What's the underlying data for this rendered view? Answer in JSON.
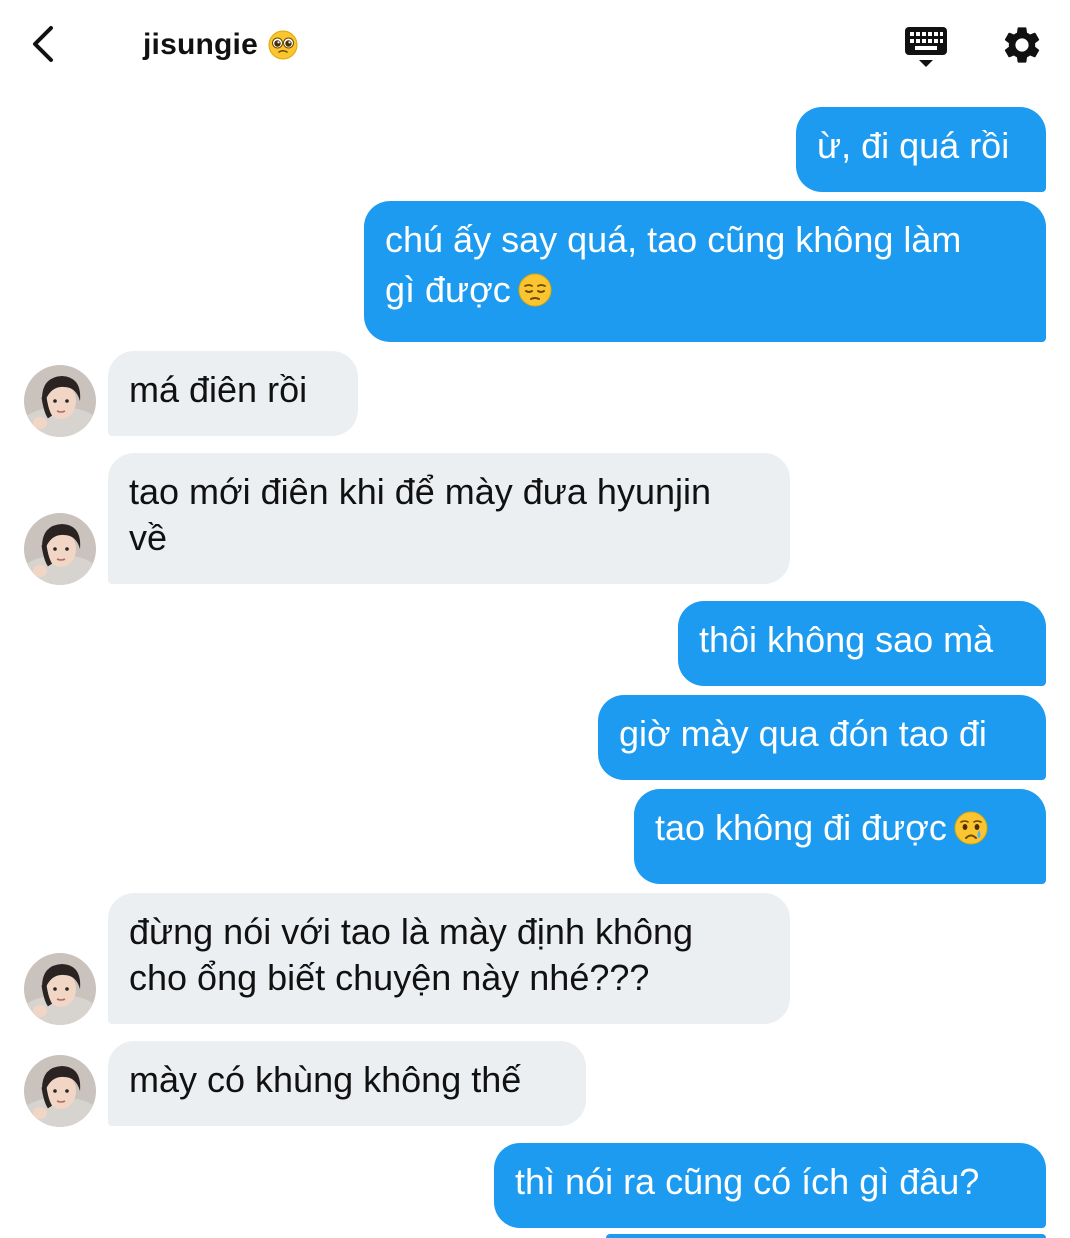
{
  "header": {
    "title": "jisungie",
    "title_emoji": "pleading-face-emoji",
    "icons": {
      "back": "chevron-left-icon",
      "keyboard": "keyboard-icon",
      "settings": "gear-icon"
    }
  },
  "colors": {
    "outgoing_bubble": "#1d9bf0",
    "incoming_bubble": "#eceff2",
    "outgoing_text": "#ffffff",
    "incoming_text": "#111111"
  },
  "messages": [
    {
      "direction": "out",
      "lines": [
        "ừ, đi quá rồi"
      ]
    },
    {
      "direction": "out",
      "lines": [
        "chú ấy say quá, tao cũng không làm",
        "gì được"
      ],
      "emoji": "pensive-face-emoji"
    },
    {
      "direction": "in",
      "lines": [
        "má điên rồi"
      ],
      "avatar": "avatar"
    },
    {
      "direction": "in",
      "lines": [
        "tao mới điên khi để mày đưa hyunjin",
        "về"
      ],
      "avatar": "avatar"
    },
    {
      "direction": "out",
      "lines": [
        "thôi không sao mà"
      ]
    },
    {
      "direction": "out",
      "lines": [
        "giờ mày qua đón tao đi"
      ]
    },
    {
      "direction": "out",
      "lines": [
        "tao không đi được"
      ],
      "emoji": "crying-face-emoji"
    },
    {
      "direction": "in",
      "lines": [
        "đừng nói với tao là mày định không",
        "cho ổng biết chuyện này nhé???"
      ],
      "avatar": "avatar"
    },
    {
      "direction": "in",
      "lines": [
        "mày có khùng không thế"
      ],
      "avatar": "avatar"
    },
    {
      "direction": "out",
      "lines": [
        "thì nói ra cũng có ích gì đâu?"
      ]
    }
  ]
}
